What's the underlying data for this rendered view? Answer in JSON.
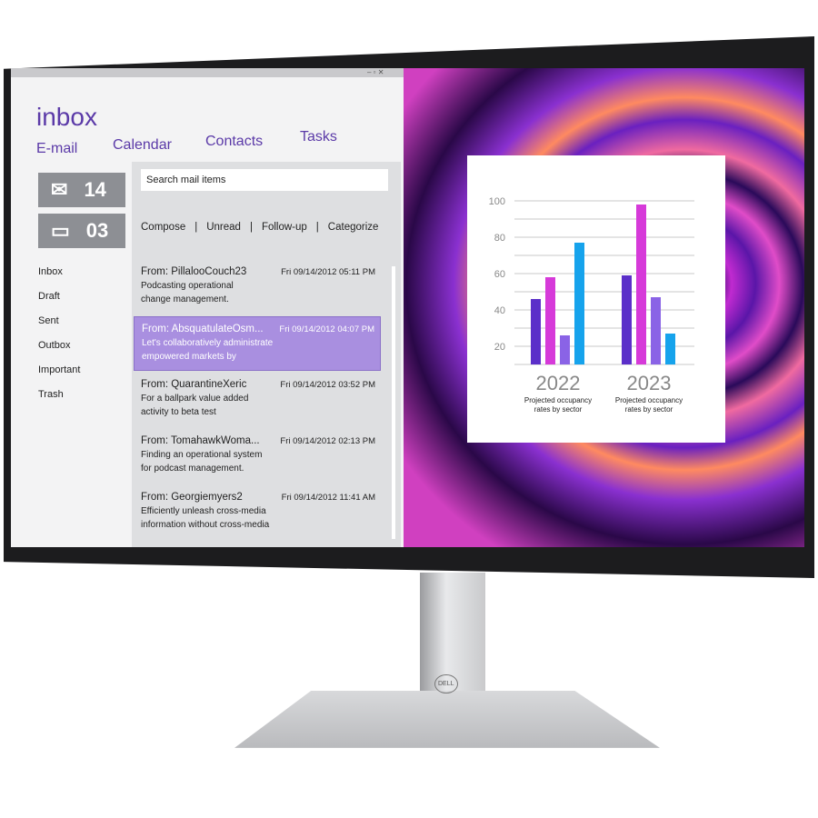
{
  "app": {
    "title": "inbox",
    "nav": [
      "E-mail",
      "Calendar",
      "Contacts",
      "Tasks"
    ],
    "counters": [
      {
        "icon": "envelope-icon",
        "count": "14"
      },
      {
        "icon": "chat-bubble-icon",
        "count": "03"
      }
    ],
    "folders": [
      "Inbox",
      "Draft",
      "Sent",
      "Outbox",
      "Important",
      "Trash"
    ],
    "search_placeholder": "Search mail items",
    "actions": [
      "Compose",
      "|",
      "Unread",
      "|",
      "Follow-up",
      "|",
      "Categorize"
    ],
    "mails": [
      {
        "from": "From: PillalooCouch23",
        "date": "Fri 09/14/2012 05:11 PM",
        "line1": "Podcasting operational",
        "line2": "change management."
      },
      {
        "from": "From: AbsquatulateOsm...",
        "date": "Fri 09/14/2012 04:07 PM",
        "line1": "Let's collaboratively administrate",
        "line2": "empowered markets by"
      },
      {
        "from": "From: QuarantineXeric",
        "date": "Fri 09/14/2012 03:52 PM",
        "line1": "For a ballpark value added",
        "line2": "activity to beta test"
      },
      {
        "from": "From: TomahawkWoma...",
        "date": "Fri 09/14/2012 02:13 PM",
        "line1": "Finding an operational system",
        "line2": "for podcast management."
      },
      {
        "from": "From: Georgiemyers2",
        "date": "Fri 09/14/2012 11:41 AM",
        "line1": "Efficiently unleash cross-media",
        "line2": "information without cross-media"
      }
    ],
    "selected_mail": 1,
    "accent": "#5b3aa8"
  },
  "window_controls": "– ▫ ✕",
  "brand": "DELL",
  "chart_data": {
    "type": "bar",
    "categories": [
      "2022",
      "2023"
    ],
    "group_captions": [
      "Projected occupancy rates by sector",
      "Projected occupancy rates by sector"
    ],
    "series": [
      {
        "color": "#5b2fc9",
        "values": [
          46,
          59
        ]
      },
      {
        "color": "#d63ad9",
        "values": [
          58,
          98
        ]
      },
      {
        "color": "#8a63e6",
        "values": [
          26,
          47
        ]
      },
      {
        "color": "#16a3ec",
        "values": [
          77,
          27
        ]
      }
    ],
    "yticks": [
      20,
      40,
      60,
      80,
      100
    ],
    "ylim": [
      10,
      105
    ],
    "grid": true
  }
}
